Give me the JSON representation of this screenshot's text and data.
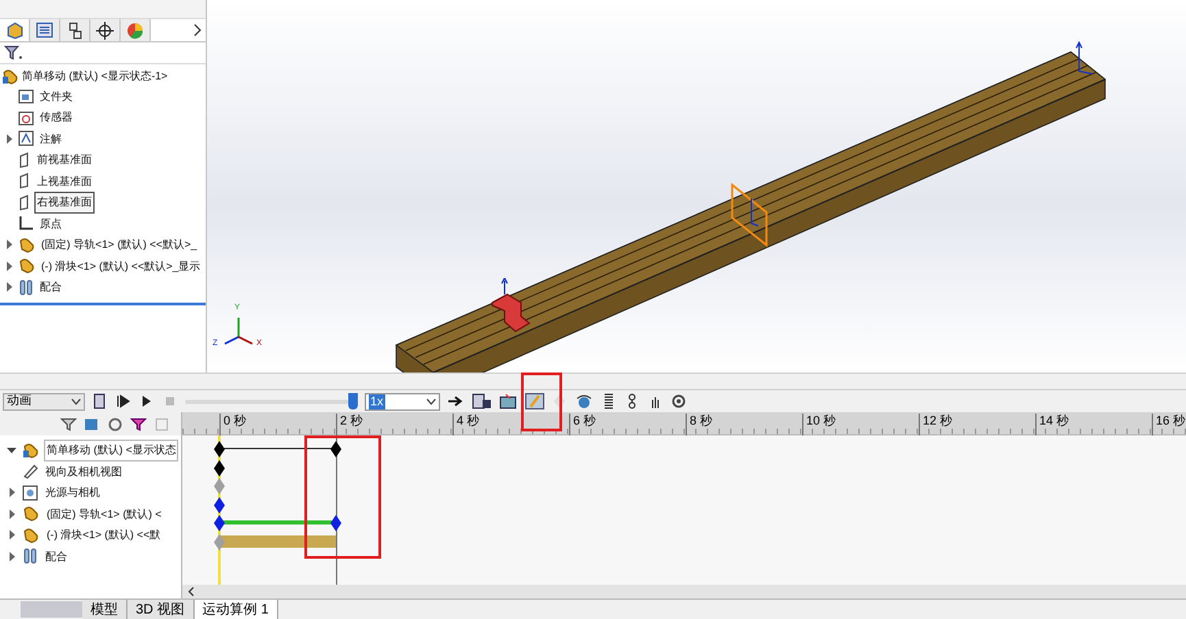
{
  "feature_panel": {
    "tabs": [
      {
        "kind": "features",
        "selected": true
      },
      {
        "kind": "properties",
        "selected": false
      },
      {
        "kind": "config",
        "selected": false
      },
      {
        "kind": "dimxpert",
        "selected": false
      },
      {
        "kind": "display",
        "selected": false
      }
    ],
    "root": "简单移动 (默认) <显示状态-1>",
    "items": [
      {
        "label": "文件夹",
        "kind": "folder",
        "expandable": false,
        "selected": false
      },
      {
        "label": "传感器",
        "kind": "sensor",
        "expandable": false,
        "selected": false
      },
      {
        "label": "注解",
        "kind": "annotation",
        "expandable": true,
        "selected": false
      },
      {
        "label": "前视基准面",
        "kind": "plane",
        "expandable": false,
        "selected": false
      },
      {
        "label": "上视基准面",
        "kind": "plane",
        "expandable": false,
        "selected": false
      },
      {
        "label": "右视基准面",
        "kind": "plane",
        "expandable": false,
        "selected": true
      },
      {
        "label": "原点",
        "kind": "origin",
        "expandable": false,
        "selected": false
      },
      {
        "label": "(固定) 导轨<1> (默认) <<默认>_",
        "kind": "part",
        "expandable": true,
        "selected": false
      },
      {
        "label": "(-) 滑块<1> (默认) <<默认>_显示",
        "kind": "part",
        "expandable": true,
        "selected": false
      },
      {
        "label": "配合",
        "kind": "mates",
        "expandable": true,
        "selected": false
      }
    ]
  },
  "viewport": {
    "triad": [
      "Y",
      "Z",
      "X"
    ]
  },
  "motion_study": {
    "study_type": "动画",
    "speed_slider": {
      "level": 0.98
    },
    "playback_speed": "1x",
    "ruler": [
      "0 秒",
      "2 秒",
      "4 秒",
      "6 秒",
      "8 秒",
      "10 秒",
      "12 秒",
      "14 秒",
      "16 秒"
    ],
    "tree": [
      {
        "label": "简单移动 (默认) <显示状态",
        "kind": "assembly",
        "expandable": true,
        "expanded": true,
        "selected": true,
        "track": {
          "kind": "span",
          "color": "#000000"
        }
      },
      {
        "label": "视向及相机视图",
        "kind": "camera",
        "expandable": false,
        "selected": false,
        "track": {
          "kind": "key",
          "color": "#000000"
        }
      },
      {
        "label": "光源与相机",
        "kind": "lights",
        "expandable": true,
        "expanded": false,
        "selected": false,
        "track": {
          "kind": "key",
          "color": "#a0a0a0"
        }
      },
      {
        "label": "(固定) 导轨<1> (默认) <",
        "kind": "part",
        "expandable": true,
        "expanded": false,
        "selected": false,
        "track": {
          "kind": "key",
          "color": "#1020e0"
        }
      },
      {
        "label": "(-) 滑块<1> (默认) <<默",
        "kind": "part",
        "expandable": true,
        "expanded": false,
        "selected": false,
        "track": {
          "kind": "motion",
          "color": "#1020e0"
        }
      },
      {
        "label": "配合",
        "kind": "mates",
        "expandable": true,
        "expanded": false,
        "selected": false,
        "track": {
          "kind": "mate",
          "color": "#a0a0a0"
        }
      }
    ]
  },
  "bottom_tabs": [
    {
      "label": "模型",
      "selected": false
    },
    {
      "label": "3D 视图",
      "selected": false
    },
    {
      "label": "运动算例 1",
      "selected": true
    }
  ]
}
